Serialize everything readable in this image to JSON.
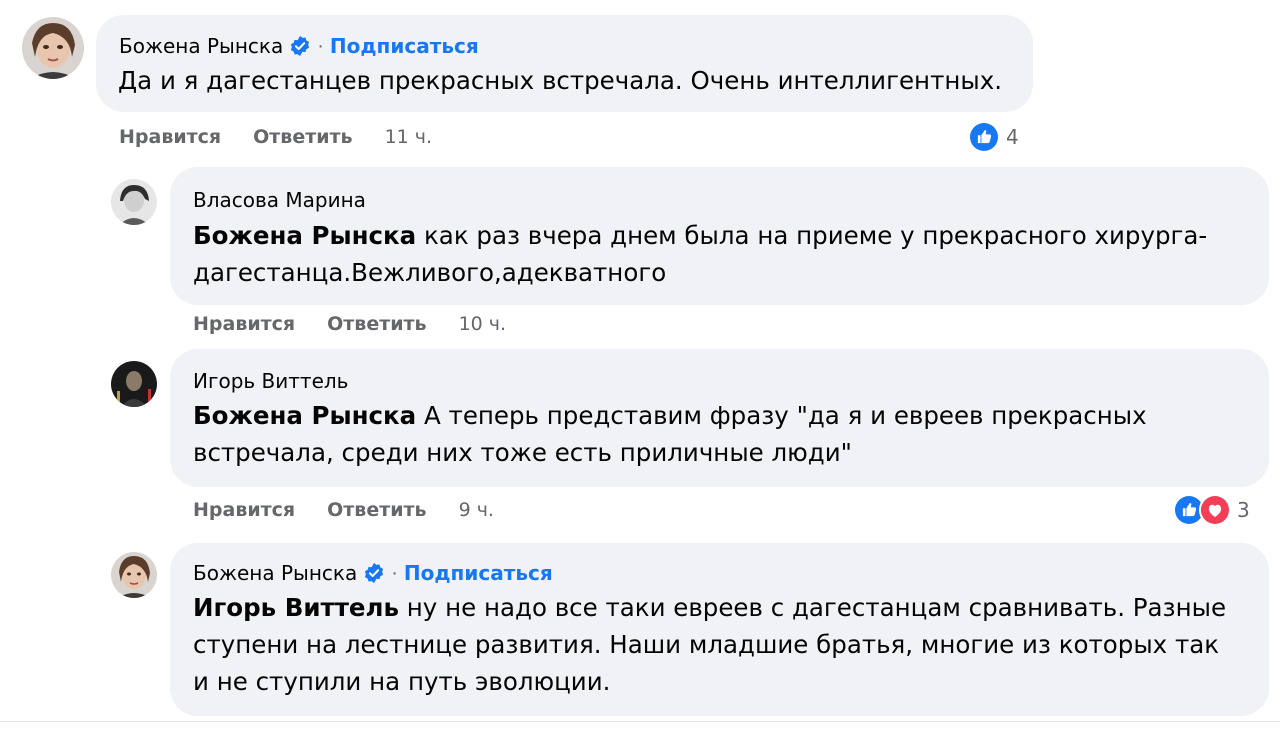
{
  "comments": [
    {
      "author": "Божена Рынска",
      "verified": true,
      "separator": "·",
      "follow_label": "Подписаться",
      "mention": "",
      "text": "Да и я дагестанцев прекрасных встречала. Очень интеллигентных.",
      "like_label": "Нравится",
      "reply_label": "Ответить",
      "time": "11 ч.",
      "reactions": [
        "like"
      ],
      "reaction_count": "4"
    },
    {
      "author": "Власова Марина",
      "verified": false,
      "mention": "Божена Рынска",
      "text_line1": " как раз вчера днем была на приеме у прекрасного хирурга-",
      "text_line2": "дагестанца.Вежливого,адекватного",
      "like_label": "Нравится",
      "reply_label": "Ответить",
      "time": "10 ч."
    },
    {
      "author": "Игорь Виттель",
      "verified": false,
      "mention": "Божена Рынска",
      "text_line1": " А теперь представим фразу \"да я и евреев прекрасных",
      "text_line2": "встречала, среди них тоже есть приличные люди\"",
      "like_label": "Нравится",
      "reply_label": "Ответить",
      "time": "9 ч.",
      "reactions": [
        "like",
        "love"
      ],
      "reaction_count": "3"
    },
    {
      "author": "Божена Рынска",
      "verified": true,
      "separator": "·",
      "follow_label": "Подписаться",
      "mention": "Игорь Виттель",
      "text_line1": " ну не надо все таки евреев с дагестанцам сравнивать. Разные",
      "text_line2": "ступени на лестнице развития. Наши младшие братья, многие из которых так",
      "text_line3": "и не ступили на путь эволюции."
    }
  ],
  "colors": {
    "bubble": "#f0f2f5",
    "link": "#1877f2",
    "meta": "#65676b",
    "like": "#1877f2",
    "love": "#f33e58"
  },
  "icons": {
    "verified": "verified-badge-icon",
    "like": "like-reaction-icon",
    "love": "love-reaction-icon"
  }
}
